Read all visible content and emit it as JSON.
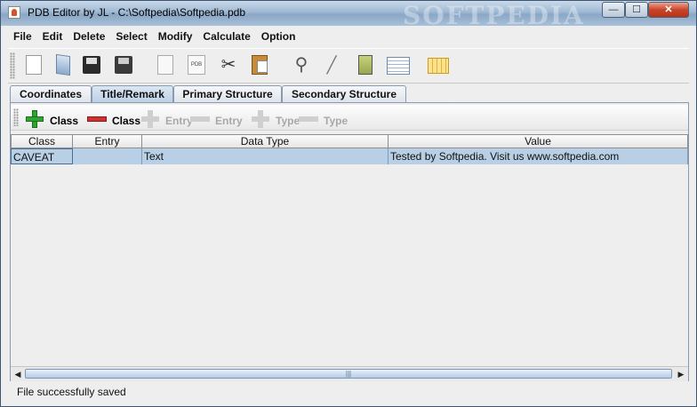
{
  "window": {
    "title": "PDB Editor by JL - C:\\Softpedia\\Softpedia.pdb",
    "watermark": "SOFTPEDIA",
    "buttons": {
      "minimize": "—",
      "maximize": "☐",
      "close": "✕"
    }
  },
  "menubar": {
    "items": [
      "File",
      "Edit",
      "Delete",
      "Select",
      "Modify",
      "Calculate",
      "Option"
    ]
  },
  "toolbar": {
    "icons": [
      "new-icon",
      "open-icon",
      "save-icon",
      "save-as-icon",
      "page-icon",
      "pdb-icon",
      "cut-icon",
      "paste-icon",
      "find-icon",
      "pen-icon",
      "calculator-icon",
      "list-icon",
      "calendar-icon"
    ],
    "pdb_label": "PDB"
  },
  "tabs": [
    {
      "label": "Coordinates"
    },
    {
      "label": "Title/Remark"
    },
    {
      "label": "Primary Structure"
    },
    {
      "label": "Secondary Structure"
    }
  ],
  "active_tab": "Title/Remark",
  "subtoolbar": {
    "add_class": "Class",
    "remove_class": "Class",
    "add_entry": "Entry",
    "remove_entry": "Entry",
    "add_type": "Type",
    "remove_type": "Type"
  },
  "table": {
    "columns": [
      "Class",
      "Entry",
      "Data Type",
      "Value"
    ],
    "rows": [
      [
        "CAVEAT",
        "",
        "Text",
        "Tested by Softpedia. Visit us www.softpedia.com"
      ]
    ]
  },
  "scrollbar": {
    "left": "◀",
    "right": "▶",
    "grip": "|||"
  },
  "status": {
    "text": "File successfully saved"
  }
}
